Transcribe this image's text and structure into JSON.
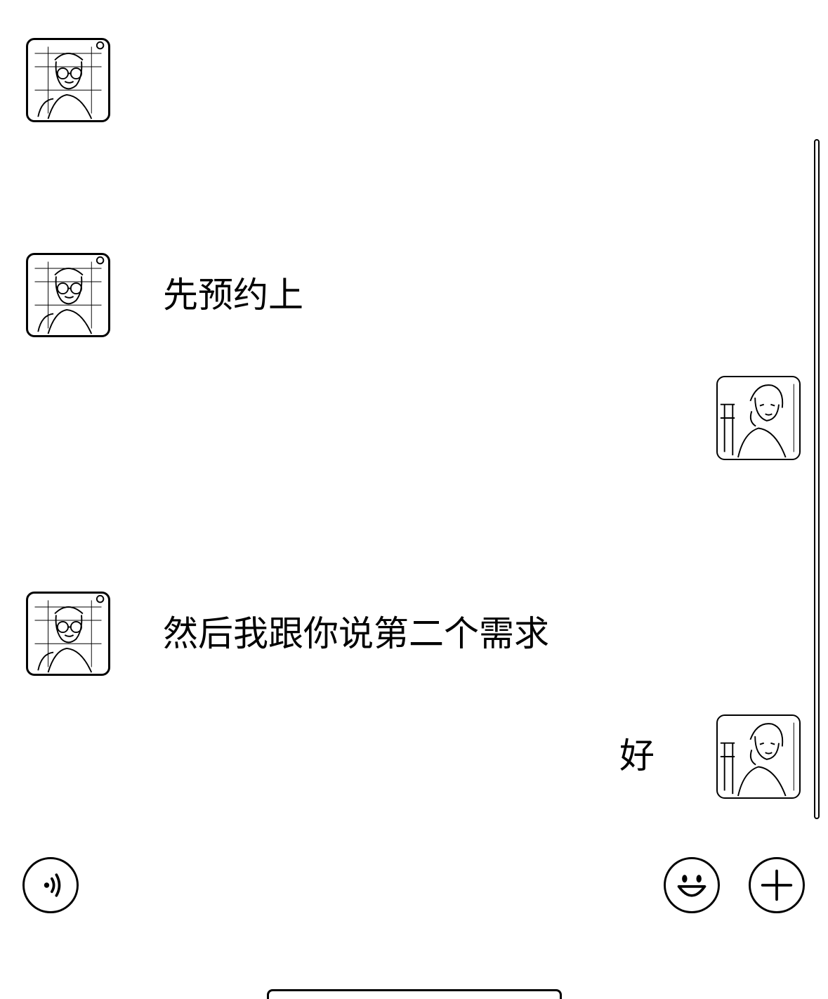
{
  "messages": [
    {
      "sender": "contact",
      "text": ""
    },
    {
      "sender": "contact",
      "text": "先预约上"
    },
    {
      "sender": "self",
      "text": ""
    },
    {
      "sender": "contact",
      "text": "然后我跟你说第二个需求"
    },
    {
      "sender": "self",
      "text": "好"
    }
  ],
  "input_bar": {
    "voice_icon": "voice-icon",
    "emoji_icon": "emoji-icon",
    "add_icon": "plus-icon"
  },
  "colors": {
    "background": "#ffffff",
    "foreground": "#000000"
  }
}
